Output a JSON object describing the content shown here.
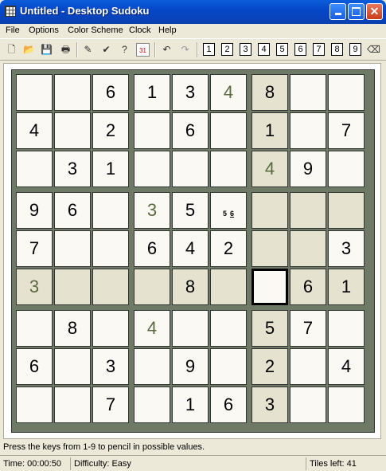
{
  "window": {
    "title": "Untitled - Desktop Sudoku"
  },
  "menu": [
    "File",
    "Options",
    "Color Scheme",
    "Clock",
    "Help"
  ],
  "toolbar": {
    "icons": [
      "new-icon",
      "open-icon",
      "save-icon",
      "print-icon",
      "magic-wand-icon",
      "check-grid-icon",
      "hint-icon",
      "pencil-mode-icon",
      "undo-icon",
      "redo-icon"
    ],
    "number_buttons": [
      "1",
      "2",
      "3",
      "4",
      "5",
      "6",
      "7",
      "8",
      "9"
    ],
    "eraser": "eraser-icon"
  },
  "colors": {
    "titlebar": "#0548C9",
    "board_bg": "#6E7A66",
    "cell_bg": "#FAF9F4",
    "cell_shaded": "#E5E2D0",
    "given_green": "#5A6A40"
  },
  "grid": [
    [
      "",
      "",
      "6",
      "1",
      "3",
      "4",
      "8",
      "",
      ""
    ],
    [
      "4",
      "",
      "2",
      "",
      "6",
      "",
      "1",
      "",
      "7"
    ],
    [
      "",
      "3",
      "1",
      "",
      "",
      "",
      "4",
      "9",
      ""
    ],
    [
      "9",
      "6",
      "",
      "3",
      "5",
      "",
      "",
      "",
      ""
    ],
    [
      "7",
      "",
      "",
      "6",
      "4",
      "2",
      "",
      "",
      "3"
    ],
    [
      "3",
      "",
      "",
      "",
      "8",
      "",
      "",
      "6",
      "1"
    ],
    [
      "",
      "8",
      "",
      "4",
      "",
      "",
      "5",
      "7",
      ""
    ],
    [
      "6",
      "",
      "3",
      "",
      "9",
      "",
      "2",
      "",
      "4"
    ],
    [
      "",
      "",
      "7",
      "",
      "1",
      "6",
      "3",
      "",
      ""
    ]
  ],
  "green_cells": [
    [
      0,
      5
    ],
    [
      2,
      6
    ],
    [
      3,
      3
    ],
    [
      5,
      0
    ],
    [
      6,
      3
    ]
  ],
  "shaded_cells": [
    [
      0,
      6
    ],
    [
      1,
      6
    ],
    [
      2,
      6
    ],
    [
      3,
      6
    ],
    [
      3,
      7
    ],
    [
      3,
      8
    ],
    [
      4,
      6
    ],
    [
      4,
      7
    ],
    [
      5,
      1
    ],
    [
      5,
      2
    ],
    [
      5,
      3
    ],
    [
      5,
      5
    ],
    [
      6,
      6
    ],
    [
      7,
      6
    ],
    [
      8,
      6
    ],
    [
      5,
      0
    ],
    [
      5,
      4
    ],
    [
      5,
      7
    ],
    [
      5,
      8
    ]
  ],
  "selected_cell": [
    5,
    6
  ],
  "pencil_marks": {
    "cell": [
      3,
      5
    ],
    "values": [
      "5",
      "6"
    ]
  },
  "hint_text": "Press the keys from 1-9 to pencil in possible values.",
  "status": {
    "time": "Time: 00:00:50",
    "difficulty": "Difficulty: Easy",
    "tiles_left": "Tiles left: 41"
  }
}
